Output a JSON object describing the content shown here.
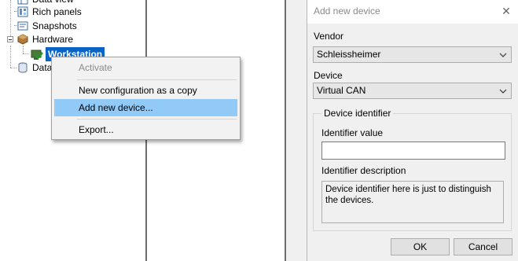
{
  "tree": {
    "items": [
      {
        "label": "Data view"
      },
      {
        "label": "Rich panels"
      },
      {
        "label": "Snapshots"
      },
      {
        "label": "Hardware"
      },
      {
        "label": "Workstation"
      },
      {
        "label": "Data"
      }
    ]
  },
  "context_menu": {
    "items": [
      {
        "label": "Activate",
        "state": "disabled"
      },
      {
        "label": "New configuration as a copy",
        "state": "normal"
      },
      {
        "label": "Add new device...",
        "state": "highlighted"
      },
      {
        "label": "Export...",
        "state": "normal"
      }
    ]
  },
  "dialog": {
    "title": "Add new device",
    "close_glyph": "✕",
    "vendor_label": "Vendor",
    "vendor_value": "Schleissheimer",
    "device_label": "Device",
    "device_value": "Virtual CAN",
    "identifier_group": "Device identifier",
    "identifier_value_label": "Identifier value",
    "identifier_value": "",
    "identifier_description_label": "Identifier description",
    "identifier_description": "Device identifier here is just to distinguish the devices.",
    "ok_label": "OK",
    "cancel_label": "Cancel"
  },
  "colors": {
    "selection": "#0a64c8",
    "menu_highlight": "#91c9f7",
    "dialog_bg": "#f0f0f0"
  }
}
